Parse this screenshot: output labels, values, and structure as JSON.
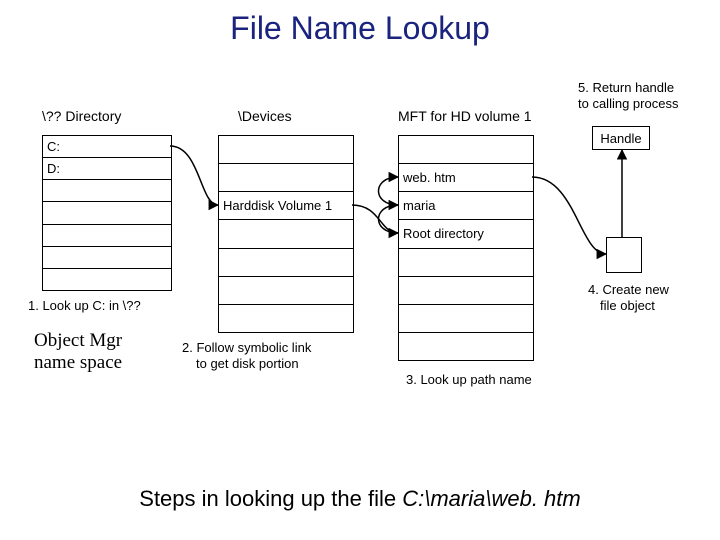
{
  "title": "File Name Lookup",
  "caption_prefix": "Steps in looking up the file ",
  "caption_path": "C:\\maria\\web. htm",
  "columns": {
    "dir": {
      "header": "\\?? Directory",
      "rows": [
        "C:",
        "D:",
        "",
        "",
        "",
        "",
        ""
      ]
    },
    "devices": {
      "header": "\\Devices",
      "rows": [
        "",
        "",
        "Harddisk Volume 1",
        "",
        "",
        "",
        ""
      ]
    },
    "mft": {
      "header": "MFT for HD volume 1",
      "rows": [
        "",
        "web. htm",
        "maria",
        "Root directory",
        "",
        "",
        "",
        ""
      ]
    }
  },
  "handle_label": "Handle",
  "annotations": {
    "step1": "1. Look up C: in \\??",
    "objmgr_l1": "Object Mgr",
    "objmgr_l2": "name space",
    "step2_l1": "2. Follow symbolic link",
    "step2_l2": "to get disk portion",
    "step3": "3. Look up path name",
    "step4_l1": "4. Create new",
    "step4_l2": "file object",
    "step5_l1": "5. Return handle",
    "step5_l2": "to calling process"
  }
}
